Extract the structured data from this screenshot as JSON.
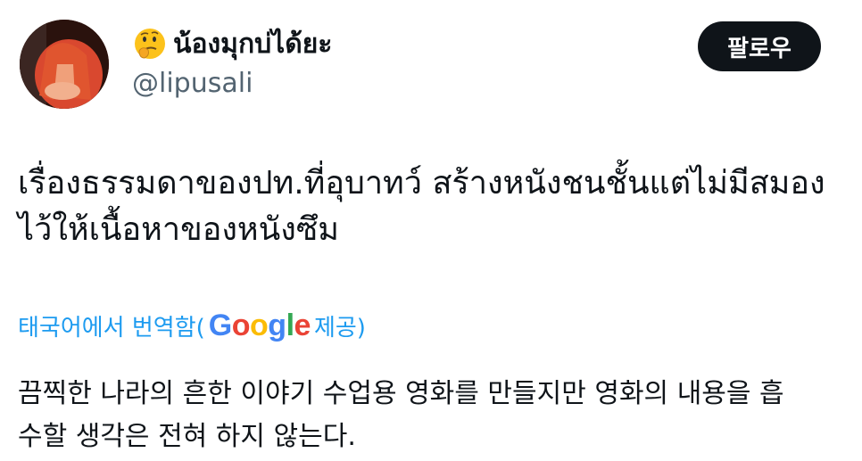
{
  "user": {
    "display_name": "น้องมุกบ่ได้ยะ",
    "handle": "@lipusali",
    "name_emoji": "thinking-face-icon"
  },
  "follow_button": {
    "label": "팔로우"
  },
  "tweet": {
    "text": "เรื่องธรรมดาของปท.ที่อุบาทว์ สร้างหนังชนชั้นแต่ไม่มีสมอง\nไว้ให้เนื้อหาของหนังซึม"
  },
  "translation": {
    "prefix": "태국어에서 번역함(",
    "google_logo": "Google",
    "suffix": " 제공)",
    "text": "끔찍한 나라의 흔한 이야기 수업용 영화를 만들지만 영화의 내용을 흡\n수할 생각은 전혀 하지 않는다."
  },
  "colors": {
    "link_blue": "#1d9bf0",
    "text_primary": "#0f1419",
    "text_secondary": "#536471",
    "button_bg": "#0f1419"
  }
}
